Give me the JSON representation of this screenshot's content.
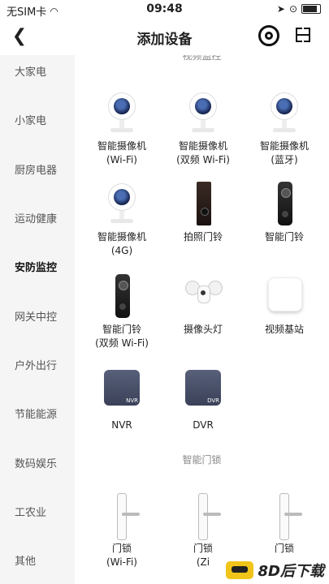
{
  "status_bar": {
    "carrier": "无SIM卡",
    "time": "09:48"
  },
  "nav": {
    "title": "添加设备"
  },
  "sidebar": {
    "items": [
      {
        "label": "大家电"
      },
      {
        "label": "小家电"
      },
      {
        "label": "厨房电器"
      },
      {
        "label": "运动健康"
      },
      {
        "label": "安防监控",
        "active": true
      },
      {
        "label": "网关中控"
      },
      {
        "label": "户外出行"
      },
      {
        "label": "节能能源"
      },
      {
        "label": "数码娱乐"
      },
      {
        "label": "工农业"
      },
      {
        "label": "其他"
      }
    ]
  },
  "sections": {
    "top_partial": "视频监控",
    "locks": "智能门锁"
  },
  "devices": [
    {
      "line1": "智能摄像机",
      "line2": "(Wi-Fi)",
      "icon": "camera-icon"
    },
    {
      "line1": "智能摄像机",
      "line2": "(双频 Wi-Fi)",
      "icon": "camera-icon"
    },
    {
      "line1": "智能摄像机",
      "line2": "(蓝牙)",
      "icon": "camera-icon"
    },
    {
      "line1": "智能摄像机",
      "line2": "(4G)",
      "icon": "camera-icon"
    },
    {
      "line1": "拍照门铃",
      "line2": "",
      "icon": "doorbell-icon"
    },
    {
      "line1": "智能门铃",
      "line2": "",
      "icon": "doorbell-icon"
    },
    {
      "line1": "智能门铃",
      "line2": "(双频 Wi-Fi)",
      "icon": "doorbell-icon"
    },
    {
      "line1": "摄像头灯",
      "line2": "",
      "icon": "floodlight-camera-icon"
    },
    {
      "line1": "视频基站",
      "line2": "",
      "icon": "base-station-icon"
    },
    {
      "line1": "NVR",
      "line2": "",
      "icon": "nvr-icon",
      "tag": "NVR"
    },
    {
      "line1": "DVR",
      "line2": "",
      "icon": "dvr-icon",
      "tag": "DVR"
    },
    {
      "line1": "门锁",
      "line2": "(Wi-Fi)",
      "icon": "door-lock-icon"
    },
    {
      "line1": "门锁",
      "line2": "(Zi",
      "icon": "door-lock-icon"
    },
    {
      "line1": "门锁",
      "line2": "",
      "icon": "door-lock-icon"
    }
  ],
  "watermark": {
    "text": "8D后下载"
  }
}
